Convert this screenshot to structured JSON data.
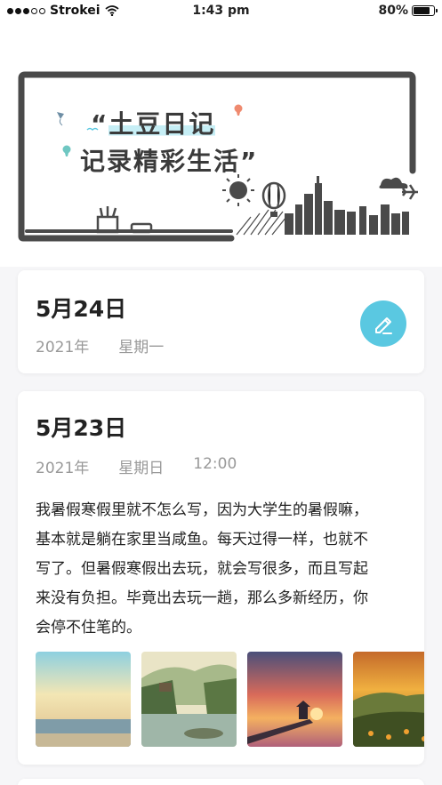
{
  "status_bar": {
    "carrier": "Strokei",
    "time": "1:43 pm",
    "battery": "80%",
    "battery_level": 0.8
  },
  "banner": {
    "line1": "“土豆日记",
    "line2": "记录精彩生活”"
  },
  "entries": [
    {
      "day": "5月24日",
      "year": "2021年",
      "weekday": "星期一"
    },
    {
      "day": "5月23日",
      "year": "2021年",
      "weekday": "星期日",
      "time": "12:00",
      "lines": [
        "我暑假寒假里就不怎么写，因为大学生的暑假嘛，",
        "基本就是躺在家里当咸鱼。每天过得一样，也就不",
        "写了。但暑假寒假出去玩，就会写很多，而且写起",
        "来没有负担。毕竟出去玩一趟，那么多新经历，你",
        "会停不住笔的。"
      ],
      "photos": [
        "sea-sky-photo",
        "pond-pavilion-photo",
        "sunset-pier-photo",
        "sunset-hills-photo"
      ]
    }
  ],
  "icons": {
    "edit": "pencil-icon",
    "wifi": "wifi-icon"
  },
  "colors": {
    "accent": "#5ac8e1",
    "highlight": "#c6eef5",
    "frame": "#4a4a4a"
  }
}
